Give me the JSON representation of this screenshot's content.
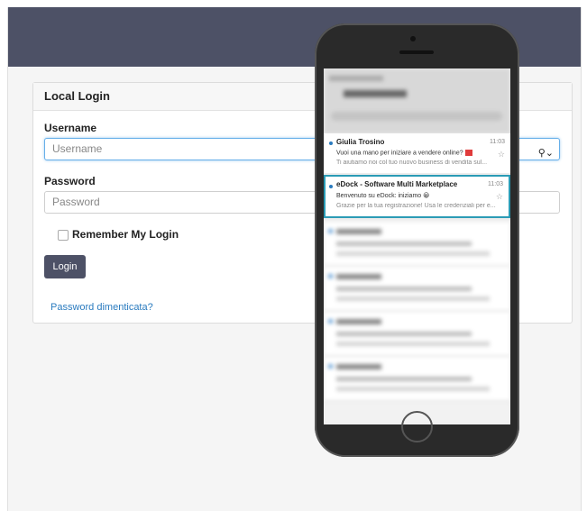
{
  "login": {
    "panel_title": "Local Login",
    "username_label": "Username",
    "username_placeholder": "Username",
    "password_label": "Password",
    "password_placeholder": "Password",
    "remember_label": "Remember My Login",
    "login_button": "Login",
    "forgot_link": "Password dimenticata?"
  },
  "icons": {
    "key": "key-icon"
  },
  "phone": {
    "emails": [
      {
        "sender": "Giulia Trosino",
        "time": "11:03",
        "subject": "Vuoi una mano per iniziare a vendere online?",
        "preview": "Ti aiutiamo noi col tuo nuovo business di vendita sul...",
        "unread": true
      },
      {
        "sender": "eDock - Software Multi Marketplace",
        "time": "11:03",
        "subject": "Benvenuto su eDock: iniziamo 😀",
        "preview": "Grazie per la tua registrazione! Usa le credenziali per e...",
        "unread": true,
        "highlighted": true
      }
    ]
  },
  "colors": {
    "header": "#4d5166",
    "button": "#4d5166",
    "link": "#2a7bbf",
    "highlight": "#2a9bb5"
  }
}
